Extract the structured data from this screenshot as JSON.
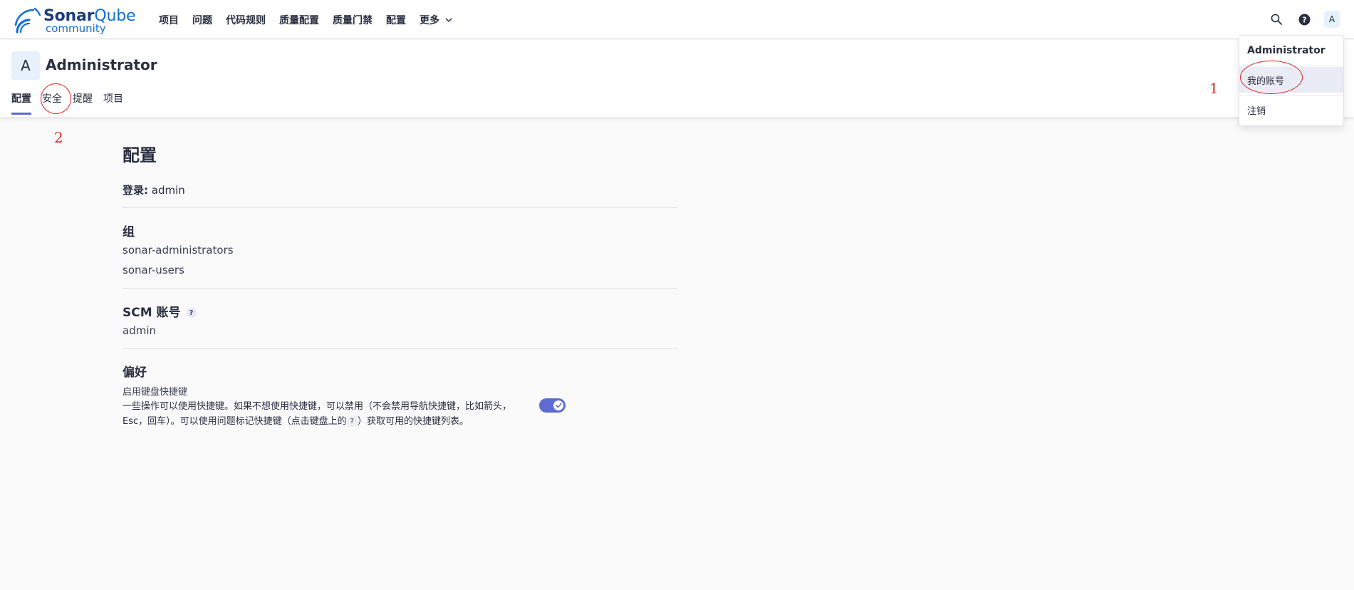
{
  "brand": {
    "name_part1": "Sonar",
    "name_part2": "Qube",
    "edition": "community",
    "primary_color": "#126ed3",
    "accent_color": "#5d6cd0"
  },
  "topnav": {
    "items": [
      "项目",
      "问题",
      "代码规则",
      "质量配置",
      "质量门禁",
      "配置"
    ],
    "more_label": "更多",
    "search_icon": "search-icon",
    "help_icon": "help-icon",
    "avatar_initial": "A"
  },
  "user": {
    "avatar_initial": "A",
    "name": "Administrator",
    "tabs": [
      {
        "label": "配置",
        "active": true
      },
      {
        "label": "安全",
        "active": false
      },
      {
        "label": "提醒",
        "active": false
      },
      {
        "label": "项目",
        "active": false
      }
    ]
  },
  "profile": {
    "title": "配置",
    "login_label": "登录:",
    "login_value": "admin",
    "groups_title": "组",
    "groups": [
      "sonar-administrators",
      "sonar-users"
    ],
    "scm_title": "SCM 账号",
    "scm_help": "?",
    "scm_accounts": [
      "admin"
    ],
    "prefs_title": "偏好",
    "pref_name": "启用键盘快捷键",
    "pref_desc_part1": "一些操作可以使用快捷键。如果不想使用快捷键，可以禁用（不会禁用导航快捷键，比如箭头，Esc，回车）。可以使用问题标记快捷键（点击键盘上的",
    "pref_desc_key": "?",
    "pref_desc_part2": "）获取可用的快捷键列表。",
    "pref_enabled": true
  },
  "dropdown": {
    "header": "Administrator",
    "items": [
      "我的账号",
      "注销"
    ]
  },
  "annotations": {
    "label1": "1",
    "label2": "2",
    "color": "#e5221f"
  }
}
